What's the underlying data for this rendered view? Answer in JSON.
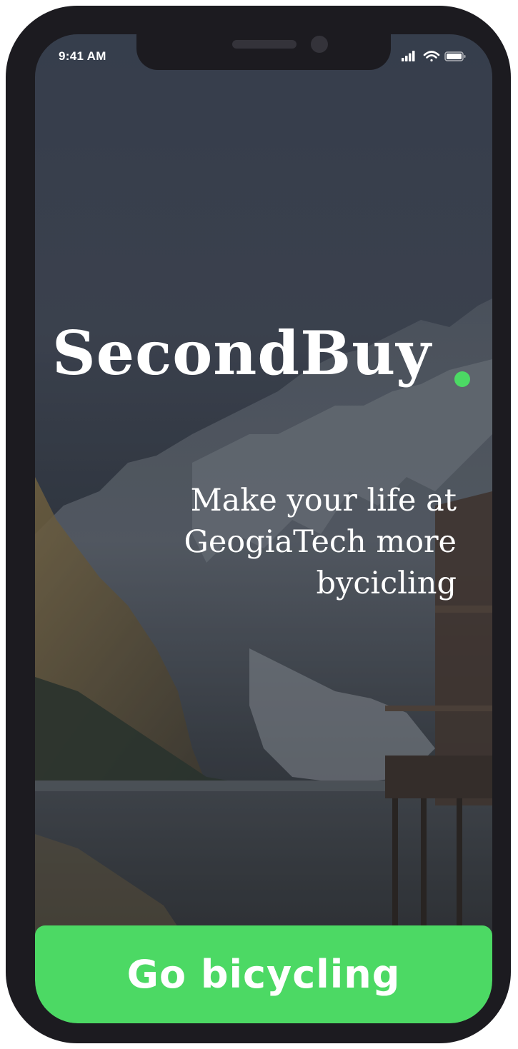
{
  "status_bar": {
    "time": "9:41 AM",
    "icons": [
      "cellular-signal-icon",
      "wifi-icon",
      "battery-icon"
    ]
  },
  "brand": {
    "name": "SecondBuy",
    "accent_color": "#4cd964"
  },
  "tagline": {
    "lines": [
      "Make your life at",
      "GeogiaTech more",
      "bycicling"
    ]
  },
  "cta": {
    "label": "Go bicycling",
    "color": "#4cd964"
  }
}
